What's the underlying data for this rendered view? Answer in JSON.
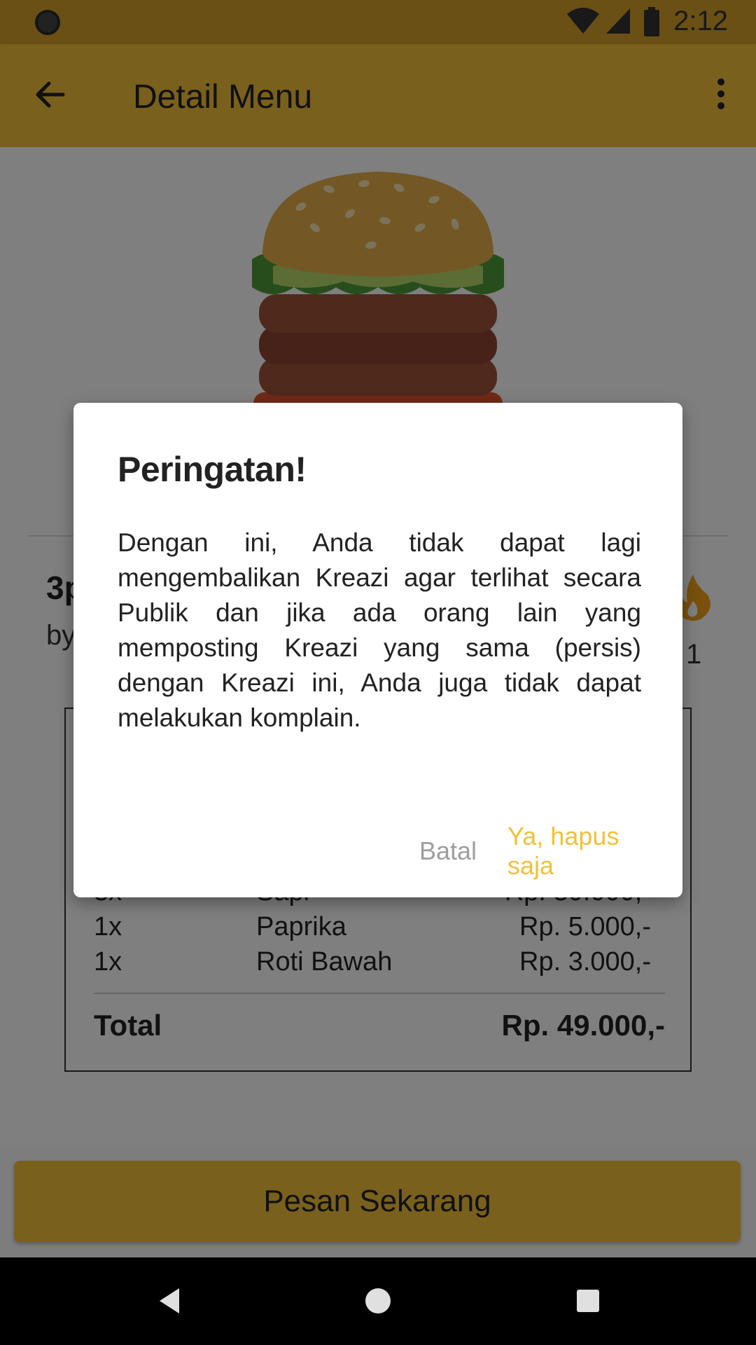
{
  "status_bar": {
    "time": "2:12"
  },
  "app_bar": {
    "title": "Detail Menu"
  },
  "item": {
    "name": "3p",
    "by": "by",
    "like_count": "1"
  },
  "details": {
    "rows": [
      {
        "qty": "3x",
        "name": "Sapi",
        "price": "Rp. 30.000,-"
      },
      {
        "qty": "1x",
        "name": "Paprika",
        "price": "Rp. 5.000,-"
      },
      {
        "qty": "1x",
        "name": "Roti Bawah",
        "price": "Rp. 3.000,-"
      }
    ],
    "total_label": "Total",
    "total_value": "Rp. 49.000,-"
  },
  "order_button": {
    "label": "Pesan Sekarang"
  },
  "dialog": {
    "title": "Peringatan!",
    "body": "Dengan ini, Anda tidak dapat lagi mengembalikan Kreazi agar terlihat secara Publik dan jika ada orang lain yang memposting Kreazi yang sama (persis) dengan Kreazi ini, Anda juga tidak dapat melakukan komplain.",
    "cancel_label": "Batal",
    "confirm_label": "Ya, hapus saja"
  },
  "colors": {
    "accent": "#f2c13a",
    "cancel_text": "#9e9e9e"
  },
  "icons": [
    "back-arrow-icon",
    "more-vert-icon",
    "wifi-icon",
    "signal-icon",
    "battery-icon",
    "flame-icon",
    "nav-back-icon",
    "nav-home-icon",
    "nav-recents-icon"
  ]
}
